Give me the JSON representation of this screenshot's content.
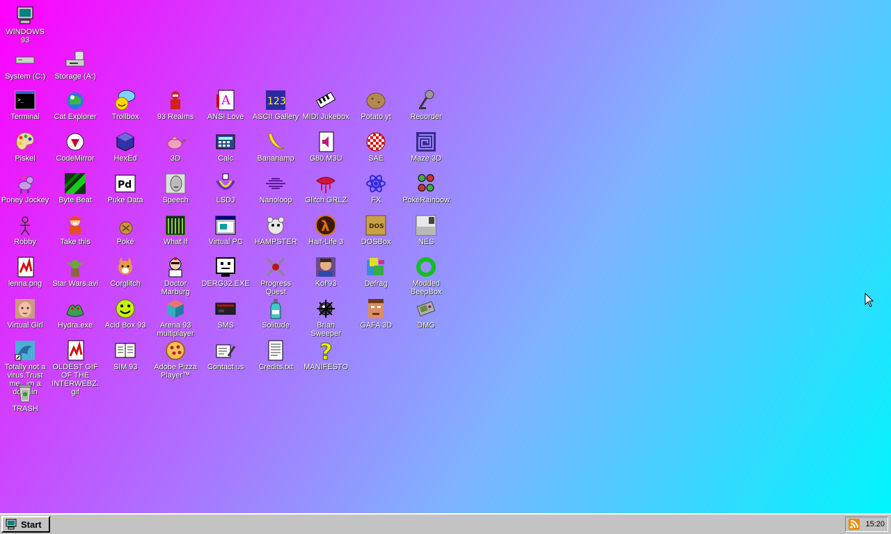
{
  "desktop": {
    "icons": [
      {
        "label": "WINDOWS 93",
        "icon": "computer-icon"
      },
      {
        "label": "System (C:)",
        "icon": "drive-icon"
      },
      {
        "label": "Storage (A:)",
        "icon": "floppy-drive-icon"
      },
      {
        "label": "Terminal",
        "icon": "terminal-icon"
      },
      {
        "label": "Cat Explorer",
        "icon": "cat-explorer-icon"
      },
      {
        "label": "Trollbox",
        "icon": "chat-icon"
      },
      {
        "label": "93 Realms",
        "icon": "knight-icon"
      },
      {
        "label": "ANSI Love",
        "icon": "ansi-icon"
      },
      {
        "label": "ASCII Gallery",
        "icon": "ascii-icon"
      },
      {
        "label": "MIDI Jukebox",
        "icon": "piano-icon"
      },
      {
        "label": "Potato.yt",
        "icon": "potato-icon"
      },
      {
        "label": "Recorder",
        "icon": "microphone-icon"
      },
      {
        "label": "Piskel",
        "icon": "palette-icon"
      },
      {
        "label": "CodeMirror",
        "icon": "codemirror-icon"
      },
      {
        "label": "HexEd",
        "icon": "cube-icon"
      },
      {
        "label": "3D",
        "icon": "teapot-icon"
      },
      {
        "label": "Calc",
        "icon": "calculator-icon"
      },
      {
        "label": "Bananamp",
        "icon": "banana-icon"
      },
      {
        "label": "G80.M3U",
        "icon": "audio-file-icon"
      },
      {
        "label": "SAE",
        "icon": "ball-icon"
      },
      {
        "label": "Maze 3D",
        "icon": "maze-icon"
      },
      {
        "label": "Poney Jockey",
        "icon": "pony-icon"
      },
      {
        "label": "Byte Beat",
        "icon": "wave-icon"
      },
      {
        "label": "Puke Data",
        "icon": "pd-icon"
      },
      {
        "label": "Speech",
        "icon": "speech-icon"
      },
      {
        "label": "LSDJ",
        "icon": "lsdj-icon"
      },
      {
        "label": "Nanoloop",
        "icon": "nanoloop-icon"
      },
      {
        "label": "Glitch GRLZ",
        "icon": "lips-icon"
      },
      {
        "label": "FX",
        "icon": "atom-icon"
      },
      {
        "label": "PokéRainbow",
        "icon": "characters-icon"
      },
      {
        "label": "Robby",
        "icon": "stickman-icon"
      },
      {
        "label": "Take this",
        "icon": "character-icon"
      },
      {
        "label": "Poké",
        "icon": "poke-icon"
      },
      {
        "label": "What If",
        "icon": "bars-icon"
      },
      {
        "label": "Virtual PC",
        "icon": "window-icon"
      },
      {
        "label": "HAMPSTER",
        "icon": "hamster-icon"
      },
      {
        "label": "Half-Life 3",
        "icon": "lambda-icon"
      },
      {
        "label": "DOSBox",
        "icon": "dosbox-icon"
      },
      {
        "label": "NES",
        "icon": "nes-icon"
      },
      {
        "label": "lenna.png",
        "icon": "image-file-icon"
      },
      {
        "label": "Star Wars.avi",
        "icon": "yoda-icon"
      },
      {
        "label": "Corglitch",
        "icon": "dog-icon"
      },
      {
        "label": "Doctor Marburg",
        "icon": "doctor-icon"
      },
      {
        "label": "DERG32.EXE",
        "icon": "monitor-face-icon"
      },
      {
        "label": "Progress Quest",
        "icon": "swords-icon"
      },
      {
        "label": "Kof'93",
        "icon": "fighter-icon"
      },
      {
        "label": "Defrag",
        "icon": "defrag-icon"
      },
      {
        "label": "Modded BeepBox",
        "icon": "ring-icon"
      },
      {
        "label": "Virtual Girl",
        "icon": "face-icon"
      },
      {
        "label": "Hydra.exe",
        "icon": "dragon-icon"
      },
      {
        "label": "Acid Box 93",
        "icon": "smiley-icon"
      },
      {
        "label": "Arena 93 multiplayer",
        "icon": "arena-cube-icon"
      },
      {
        "label": "SMS",
        "icon": "console-icon"
      },
      {
        "label": "Solitude",
        "icon": "bottle-icon"
      },
      {
        "label": "Brian Sweeper",
        "icon": "mine-icon"
      },
      {
        "label": "GAFA 3D",
        "icon": "doom-face-icon"
      },
      {
        "label": "DMG",
        "icon": "gameboy-icon"
      },
      {
        "label": "Totally not a virus.Trust me...im a dolphin",
        "icon": "dolphin-icon"
      },
      {
        "label": "OLDEST GIF OF THE INTERWEBZ.gif",
        "icon": "gif-file-icon"
      },
      {
        "label": "SIM 93",
        "icon": "book-icon"
      },
      {
        "label": "Adobe Pizza Player™",
        "icon": "pizza-icon"
      },
      {
        "label": "Contact us",
        "icon": "contact-icon"
      },
      {
        "label": "Credits.txt",
        "icon": "text-file-icon"
      },
      {
        "label": "MANIFESTO",
        "icon": "question-icon"
      },
      {
        "label": "TRASH",
        "icon": "trash-icon"
      }
    ]
  },
  "taskbar": {
    "start_label": "Start",
    "clock": "15:20"
  }
}
